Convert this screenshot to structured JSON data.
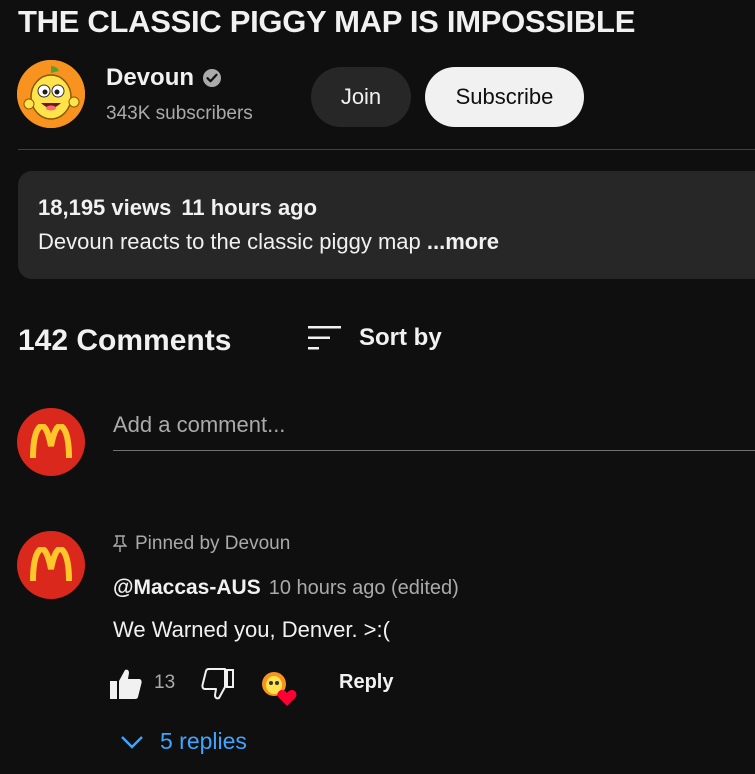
{
  "video": {
    "title": "THE CLASSIC PIGGY MAP IS IMPOSSIBLE"
  },
  "channel": {
    "name": "Devoun",
    "subscribers": "343K subscribers",
    "join_label": "Join",
    "subscribe_label": "Subscribe"
  },
  "description": {
    "views": "18,195 views",
    "time": "11 hours ago",
    "text": "Devoun reacts to the classic piggy map ",
    "more": "...more"
  },
  "comments": {
    "count_label": "142 Comments",
    "sort_label": "Sort by",
    "add_placeholder": "Add a comment...",
    "pinned_comment": {
      "pinned_label": "Pinned by Devoun",
      "author": "@Maccas-AUS",
      "time": "10 hours ago (edited)",
      "text": "We Warned you, Denver. >:(",
      "likes": "13",
      "reply_label": "Reply",
      "replies_label": "5 replies"
    }
  },
  "colors": {
    "background": "#0f0f0f",
    "accent_link": "#3ea6ff",
    "mcdonalds_red": "#da291c",
    "mcdonalds_yellow": "#ffc72c"
  }
}
